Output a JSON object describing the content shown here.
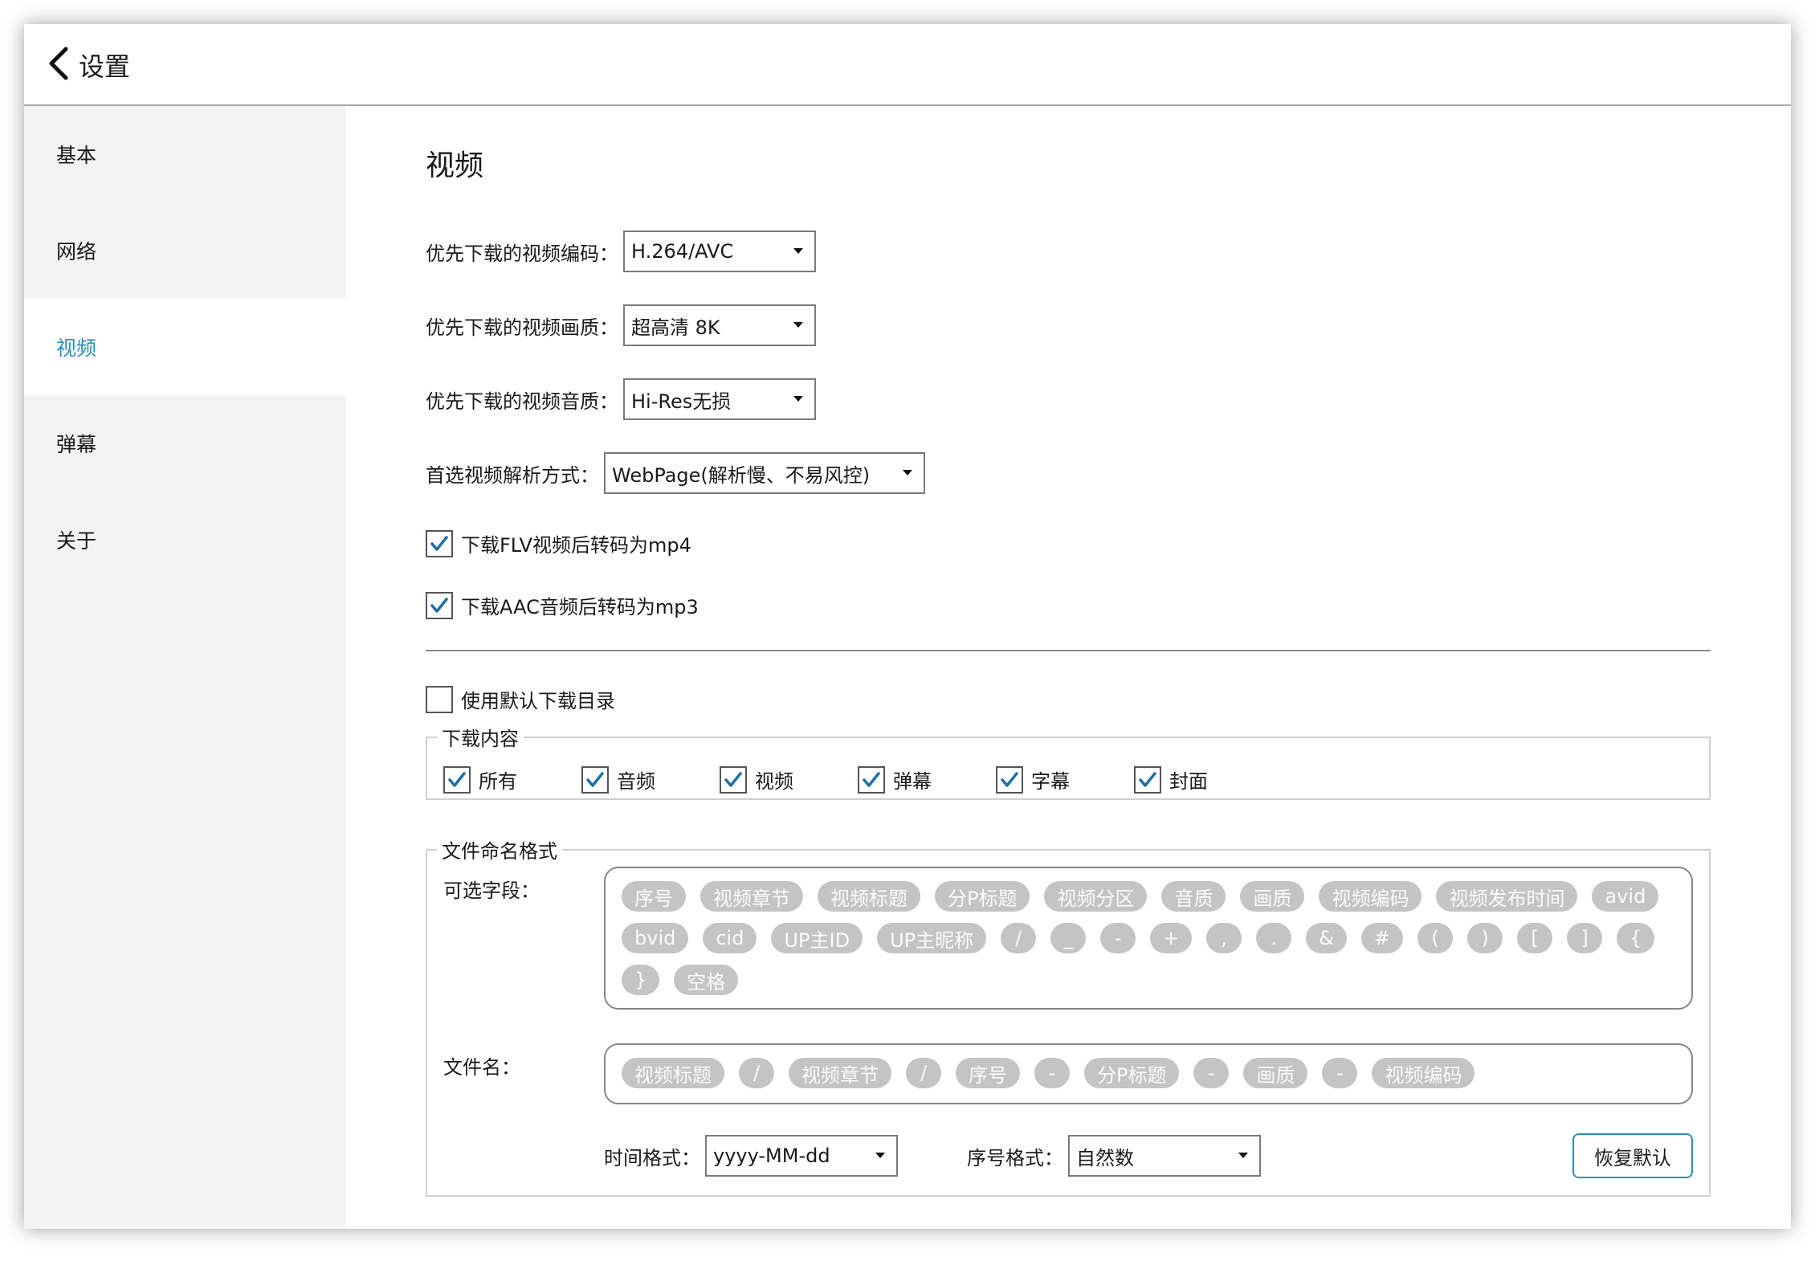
{
  "header": {
    "title": "设置",
    "back_icon": "chevron-left-icon"
  },
  "sidebar": {
    "items": [
      {
        "label": "基本",
        "active": false
      },
      {
        "label": "网络",
        "active": false
      },
      {
        "label": "视频",
        "active": true
      },
      {
        "label": "弹幕",
        "active": false
      },
      {
        "label": "关于",
        "active": false
      }
    ]
  },
  "main": {
    "section_title": "视频",
    "codec": {
      "label": "优先下载的视频编码：",
      "value": "H.264/AVC"
    },
    "quality": {
      "label": "优先下载的视频画质：",
      "value": "超高清 8K"
    },
    "audio": {
      "label": "优先下载的视频音质：",
      "value": "Hi-Res无损"
    },
    "parse": {
      "label": "首选视频解析方式：",
      "value": "WebPage(解析慢、不易风控)"
    },
    "flv_to_mp4": {
      "label": "下载FLV视频后转码为mp4",
      "checked": true
    },
    "aac_to_mp3": {
      "label": "下载AAC音频后转码为mp3",
      "checked": true
    },
    "use_default_dir": {
      "label": "使用默认下载目录",
      "checked": false
    },
    "download_content": {
      "legend": "下载内容",
      "items": [
        {
          "label": "所有",
          "checked": true
        },
        {
          "label": "音频",
          "checked": true
        },
        {
          "label": "视频",
          "checked": true
        },
        {
          "label": "弹幕",
          "checked": true
        },
        {
          "label": "字幕",
          "checked": true
        },
        {
          "label": "封面",
          "checked": true
        }
      ]
    },
    "file_naming": {
      "legend": "文件命名格式",
      "optional_label": "可选字段：",
      "optional_fields": [
        "序号",
        "视频章节",
        "视频标题",
        "分P标题",
        "视频分区",
        "音质",
        "画质",
        "视频编码",
        "视频发布时间",
        "avid",
        "bvid",
        "cid",
        "UP主ID",
        "UP主昵称",
        "/",
        "_",
        "-",
        "+",
        ",",
        ".",
        "&",
        "#",
        "(",
        ")",
        "[",
        "]",
        "{",
        "}",
        "空格"
      ],
      "filename_label": "文件名：",
      "filename_fields": [
        "视频标题",
        "/",
        "视频章节",
        "/",
        "序号",
        "-",
        "分P标题",
        "-",
        "画质",
        "-",
        "视频编码"
      ],
      "time_format": {
        "label": "时间格式：",
        "value": "yyyy-MM-dd"
      },
      "number_format": {
        "label": "序号格式：",
        "value": "自然数"
      },
      "restore_label": "恢复默认"
    }
  },
  "colors": {
    "accent": "#2a8fbd",
    "chip": "#c4c4c4",
    "check": "#1f6fa3"
  }
}
